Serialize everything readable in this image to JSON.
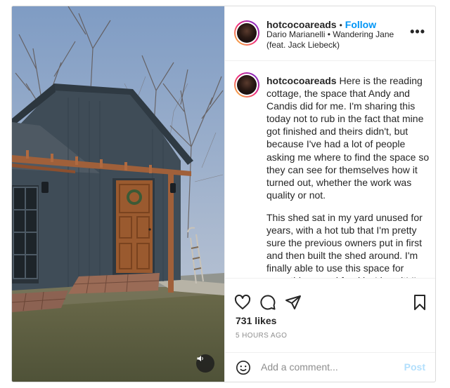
{
  "post": {
    "username": "hotcocoareads",
    "follow_label": "Follow",
    "audio_line1": "Dario Marianelli • Wandering Jane",
    "audio_line2": "(feat. Jack Liebeck)",
    "caption_username": "hotcocoareads",
    "caption_p1": "Here is the reading cottage, the space that Andy and Candis did for me. I'm sharing this today not to rub in the fact that mine got finished and theirs didn't, but because I've had a lot of people asking me where to find the space so they can see for themselves how it turned out, whether the work was quality or not.",
    "caption_p2": "This shed sat in my yard unused for years, with a hot tub that I'm pretty sure the previous owners put in first and then built the shed around. I'm finally able to use this space for something—and frankly, I love it! I'm not saying that the construction was a perfect experience. Most of you were",
    "likes": "731 likes",
    "time_ago": "5 HOURS AGO",
    "comment_placeholder": "Add a comment...",
    "post_label": "Post"
  },
  "icons": [
    "more-options-icon",
    "heart-icon",
    "comment-icon",
    "share-icon",
    "save-icon",
    "emoji-icon",
    "sound-icon"
  ],
  "colors": {
    "accent": "#0095f6",
    "post_disabled": "#b2dffc",
    "muted": "#8e8e8e",
    "text": "#262626"
  }
}
